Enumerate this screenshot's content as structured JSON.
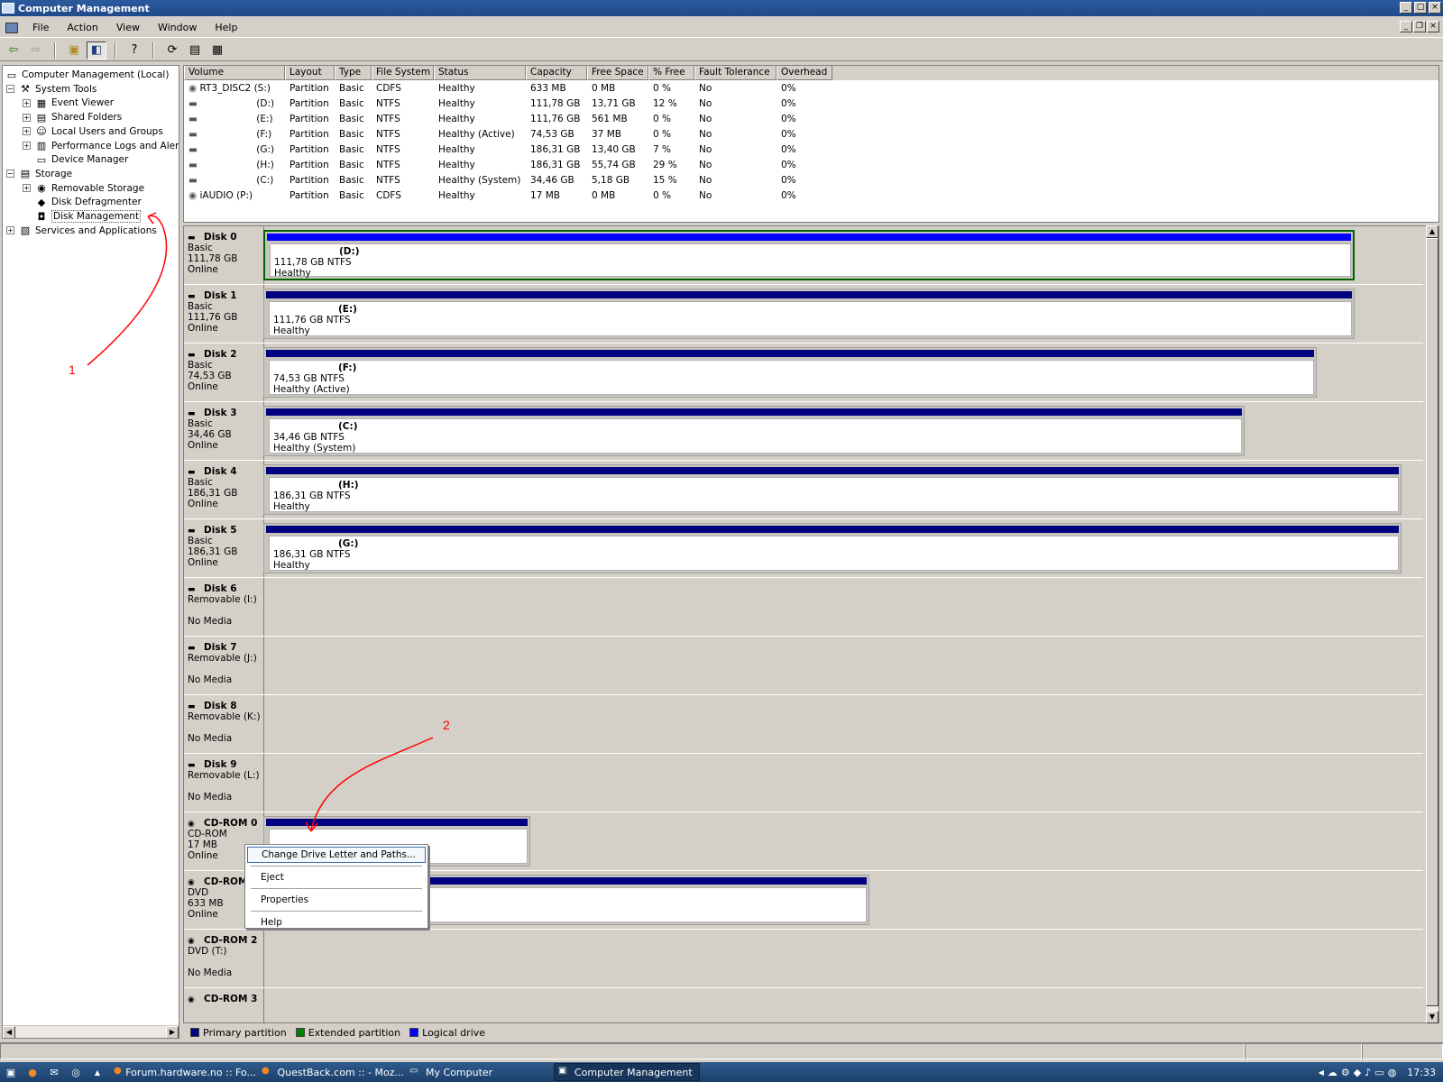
{
  "window": {
    "title": "Computer Management"
  },
  "menu": [
    "File",
    "Action",
    "View",
    "Window",
    "Help"
  ],
  "tree": [
    {
      "label": "Computer Management (Local)",
      "level": 0,
      "expander": ""
    },
    {
      "label": "System Tools",
      "level": 1,
      "expander": "−"
    },
    {
      "label": "Event Viewer",
      "level": 2,
      "expander": "+"
    },
    {
      "label": "Shared Folders",
      "level": 2,
      "expander": "+"
    },
    {
      "label": "Local Users and Groups",
      "level": 2,
      "expander": "+"
    },
    {
      "label": "Performance Logs and Alerts",
      "level": 2,
      "expander": "+"
    },
    {
      "label": "Device Manager",
      "level": 2,
      "expander": ""
    },
    {
      "label": "Storage",
      "level": 1,
      "expander": "−"
    },
    {
      "label": "Removable Storage",
      "level": 2,
      "expander": "+"
    },
    {
      "label": "Disk Defragmenter",
      "level": 2,
      "expander": ""
    },
    {
      "label": "Disk Management",
      "level": 2,
      "expander": "",
      "selected": true
    },
    {
      "label": "Services and Applications",
      "level": 1,
      "expander": "+"
    }
  ],
  "volume_columns": [
    "Volume",
    "Layout",
    "Type",
    "File System",
    "Status",
    "Capacity",
    "Free Space",
    "% Free",
    "Fault Tolerance",
    "Overhead"
  ],
  "volumes": [
    [
      "RT3_DISC2 (S:)",
      "Partition",
      "Basic",
      "CDFS",
      "Healthy",
      "633 MB",
      "0 MB",
      "0 %",
      "No",
      "0%"
    ],
    [
      "(D:)",
      "Partition",
      "Basic",
      "NTFS",
      "Healthy",
      "111,78 GB",
      "13,71 GB",
      "12 %",
      "No",
      "0%"
    ],
    [
      "(E:)",
      "Partition",
      "Basic",
      "NTFS",
      "Healthy",
      "111,76 GB",
      "561 MB",
      "0 %",
      "No",
      "0%"
    ],
    [
      "(F:)",
      "Partition",
      "Basic",
      "NTFS",
      "Healthy (Active)",
      "74,53 GB",
      "37 MB",
      "0 %",
      "No",
      "0%"
    ],
    [
      "(G:)",
      "Partition",
      "Basic",
      "NTFS",
      "Healthy",
      "186,31 GB",
      "13,40 GB",
      "7 %",
      "No",
      "0%"
    ],
    [
      "(H:)",
      "Partition",
      "Basic",
      "NTFS",
      "Healthy",
      "186,31 GB",
      "55,74 GB",
      "29 %",
      "No",
      "0%"
    ],
    [
      "(C:)",
      "Partition",
      "Basic",
      "NTFS",
      "Healthy (System)",
      "34,46 GB",
      "5,18 GB",
      "15 %",
      "No",
      "0%"
    ],
    [
      "iAUDIO (P:)",
      "Partition",
      "Basic",
      "CDFS",
      "Healthy",
      "17 MB",
      "0 MB",
      "0 %",
      "No",
      "0%"
    ]
  ],
  "disks": [
    {
      "name": "Disk 0",
      "type": "Basic",
      "size": "111,78 GB",
      "state": "Online",
      "part": {
        "letter": "(D:)",
        "desc": "111,78 GB NTFS",
        "status": "Healthy",
        "kind": "logical"
      }
    },
    {
      "name": "Disk 1",
      "type": "Basic",
      "size": "111,76 GB",
      "state": "Online",
      "part": {
        "letter": "(E:)",
        "desc": "111,76 GB NTFS",
        "status": "Healthy",
        "kind": "primary"
      }
    },
    {
      "name": "Disk 2",
      "type": "Basic",
      "size": "74,53 GB",
      "state": "Online",
      "part": {
        "letter": "(F:)",
        "desc": "74,53 GB NTFS",
        "status": "Healthy (Active)",
        "kind": "primary"
      }
    },
    {
      "name": "Disk 3",
      "type": "Basic",
      "size": "34,46 GB",
      "state": "Online",
      "part": {
        "letter": "(C:)",
        "desc": "34,46 GB NTFS",
        "status": "Healthy (System)",
        "kind": "primary"
      }
    },
    {
      "name": "Disk 4",
      "type": "Basic",
      "size": "186,31 GB",
      "state": "Online",
      "part": {
        "letter": "(H:)",
        "desc": "186,31 GB NTFS",
        "status": "Healthy",
        "kind": "primary"
      }
    },
    {
      "name": "Disk 5",
      "type": "Basic",
      "size": "186,31 GB",
      "state": "Online",
      "part": {
        "letter": "(G:)",
        "desc": "186,31 GB NTFS",
        "status": "Healthy",
        "kind": "primary"
      }
    },
    {
      "name": "Disk 6",
      "type": "Removable (I:)",
      "size": "",
      "state": "No Media"
    },
    {
      "name": "Disk 7",
      "type": "Removable (J:)",
      "size": "",
      "state": "No Media"
    },
    {
      "name": "Disk 8",
      "type": "Removable (K:)",
      "size": "",
      "state": "No Media"
    },
    {
      "name": "Disk 9",
      "type": "Removable (L:)",
      "size": "",
      "state": "No Media"
    },
    {
      "name": "CD-ROM 0",
      "type": "CD-ROM",
      "size": "17 MB",
      "state": "Online",
      "part": {
        "letter": "",
        "desc": "",
        "status": "",
        "kind": "primary"
      }
    },
    {
      "name": "CD-ROM 1",
      "type": "DVD",
      "size": "633 MB",
      "state": "Online",
      "part": {
        "letter": "",
        "desc": "",
        "status": "Healthy",
        "kind": "primary"
      }
    },
    {
      "name": "CD-ROM 2",
      "type": "DVD (T:)",
      "size": "",
      "state": "No Media"
    },
    {
      "name": "CD-ROM 3",
      "type": "",
      "size": "",
      "state": ""
    }
  ],
  "context_menu": [
    "Change Drive Letter and Paths...",
    "Eject",
    "Properties",
    "Help"
  ],
  "legend": [
    "Primary partition",
    "Extended partition",
    "Logical drive"
  ],
  "legend_colors": {
    "primary": "#000080",
    "extended": "#008000",
    "logical": "#0000ff"
  },
  "annotations": {
    "one": "1",
    "two": "2"
  },
  "taskbar": {
    "tasks": [
      "Forum.hardware.no :: Fo...",
      "QuestBack.com :: - Moz...",
      "My Computer",
      "Computer Management"
    ],
    "clock": "17:33"
  }
}
